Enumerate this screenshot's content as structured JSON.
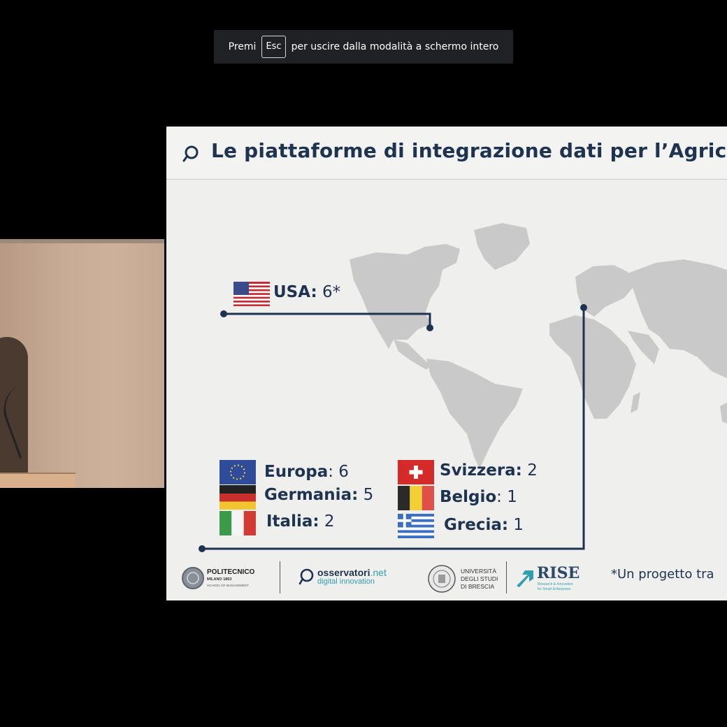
{
  "fullscreen_notice": {
    "prefix": "Premi",
    "key": "Esc",
    "suffix": "per uscire dalla modalità a schermo intero"
  },
  "slide": {
    "title": "Le piattaforme di integrazione dati per l’Agrico",
    "usa": {
      "country": "USA:",
      "count": "6*"
    },
    "countries_left": [
      {
        "country": "Europa",
        "sep": ":",
        "count": "6"
      },
      {
        "country": "Germania:",
        "sep": "",
        "count": "5"
      },
      {
        "country": "Italia:",
        "sep": "",
        "count": "2"
      }
    ],
    "countries_right": [
      {
        "country": "Svizzera:",
        "sep": "",
        "count": "2"
      },
      {
        "country": "Belgio",
        "sep": ":",
        "count": "1"
      },
      {
        "country": "Grecia:",
        "sep": "",
        "count": "1"
      }
    ],
    "footer": {
      "polimi_line1": "POLITECNICO",
      "polimi_line2": "MILANO 1863",
      "polimi_line3": "SCHOOL OF MANAGEMENT",
      "osservatori_main": "osservatori",
      "osservatori_suffix": ".net",
      "osservatori_sub": "digital innovation",
      "unibs_line1": "UNIVERSITÀ",
      "unibs_line2": "DEGLI STUDI",
      "unibs_line3": "DI BRESCIA",
      "rise": "RISE",
      "rise_sub1": "Research & Innovation",
      "rise_sub2": "for Smart Enterprises",
      "footnote": "*Un progetto tra"
    }
  },
  "colors": {
    "navy": "#1e3350",
    "map": "#c9c9c9",
    "slide_bg": "#efefee",
    "rise_teal": "#2f9fb0"
  }
}
